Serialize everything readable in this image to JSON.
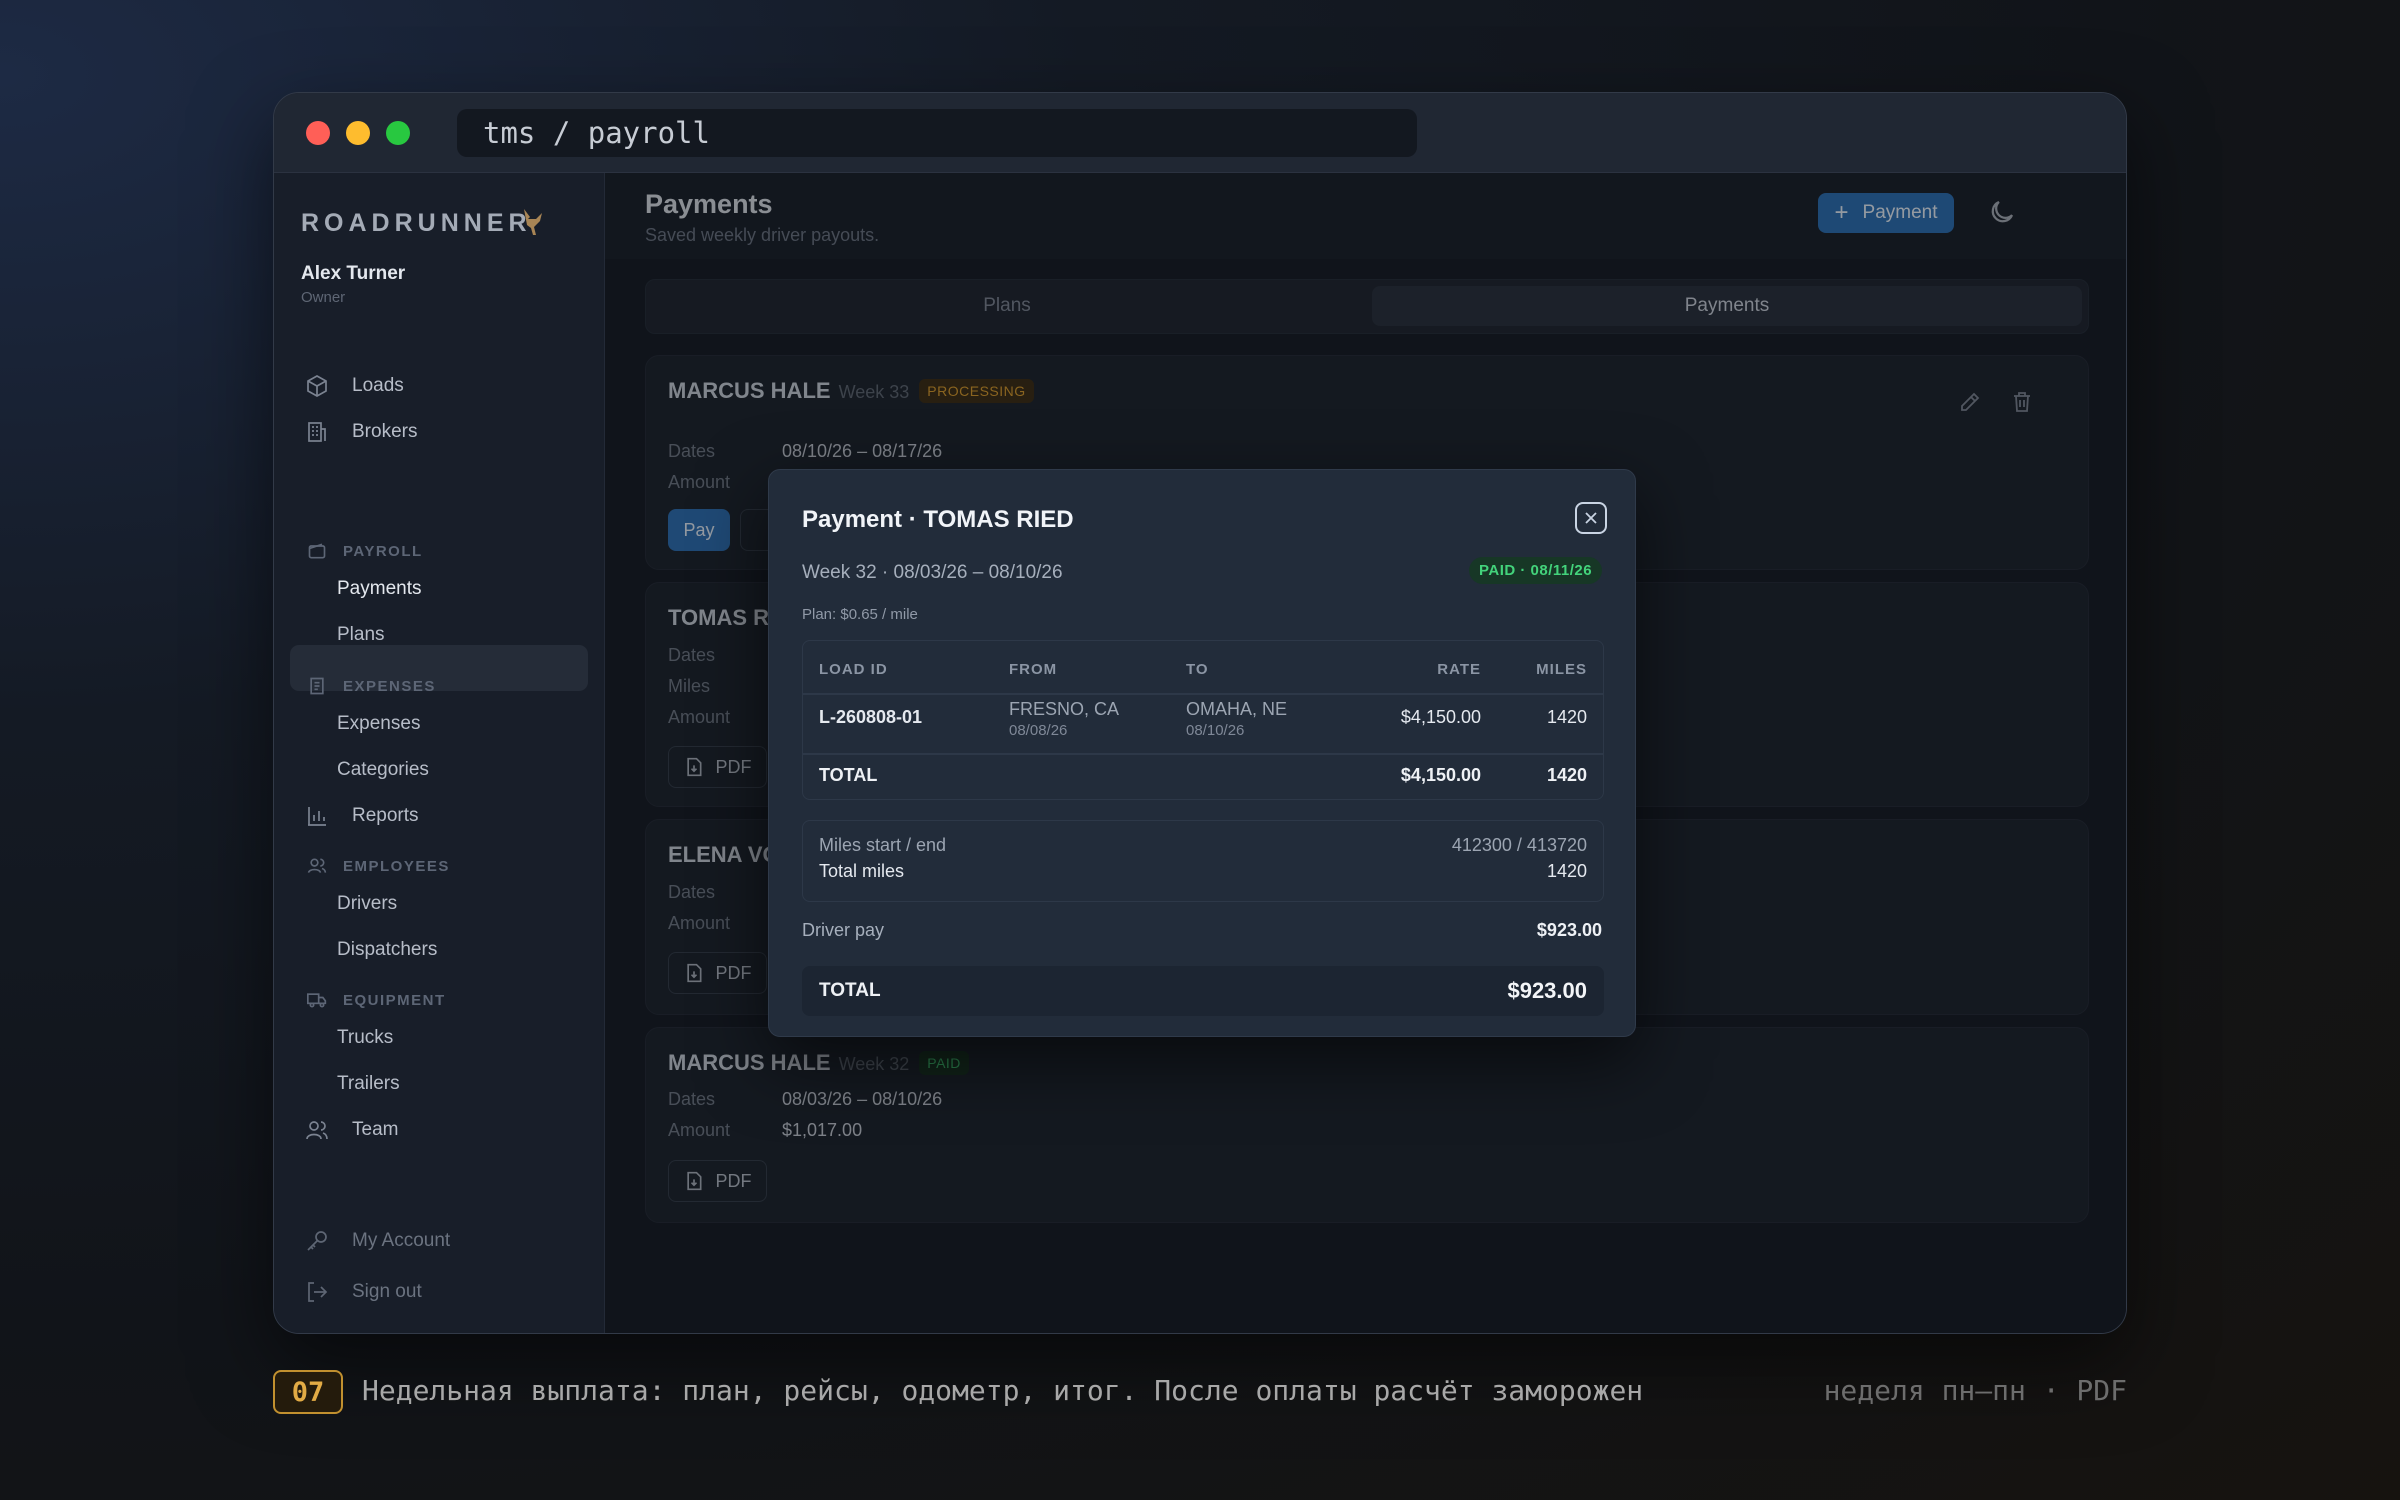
{
  "window": {
    "address": "tms / payroll"
  },
  "sidebar": {
    "brand": "ROADRUNNER",
    "user": {
      "name": "Alex Turner",
      "role": "Owner"
    },
    "items": {
      "loads": "Loads",
      "brokers": "Brokers",
      "payroll_section": "PAYROLL",
      "payments": "Payments",
      "plans": "Plans",
      "expenses_section": "EXPENSES",
      "expenses": "Expenses",
      "categories": "Categories",
      "reports": "Reports",
      "employees_section": "EMPLOYEES",
      "drivers": "Drivers",
      "dispatchers": "Dispatchers",
      "equipment_section": "EQUIPMENT",
      "trucks": "Trucks",
      "trailers": "Trailers",
      "team": "Team"
    },
    "footer": {
      "account": "My Account",
      "signout": "Sign out"
    }
  },
  "header": {
    "title": "Payments",
    "subtitle": "Saved weekly driver payouts.",
    "add_button": "Payment"
  },
  "tabs": {
    "plans": "Plans",
    "payments": "Payments"
  },
  "cards": [
    {
      "driver": "MARCUS HALE",
      "week": "Week 33",
      "status": "PROCESSING",
      "dates_label": "Dates",
      "dates": "08/10/26 – 08/17/26",
      "amount_label": "Amount",
      "pay_button": "Pay"
    },
    {
      "driver": "TOMAS RIED",
      "dates_label": "Dates",
      "miles_label": "Miles",
      "amount_label": "Amount",
      "pdf_button": "PDF"
    },
    {
      "driver": "ELENA VO",
      "dates_label": "Dates",
      "amount_label": "Amount",
      "pdf_button": "PDF"
    },
    {
      "driver": "MARCUS HALE",
      "week": "Week 32",
      "status": "PAID",
      "dates_label": "Dates",
      "dates": "08/03/26 – 08/10/26",
      "amount_label": "Amount",
      "amount": "$1,017.00",
      "pdf_button": "PDF"
    }
  ],
  "modal": {
    "title": "Payment · TOMAS RIED",
    "week": "Week 32 · 08/03/26 – 08/10/26",
    "status": "PAID · 08/11/26",
    "plan": "Plan: $0.65 / mile",
    "columns": {
      "load_id": "LOAD ID",
      "from": "FROM",
      "to": "TO",
      "rate": "RATE",
      "miles": "MILES"
    },
    "loads": [
      {
        "load_id": "L-260808-01",
        "from_city": "FRESNO, CA",
        "from_date": "08/08/26",
        "to_city": "OMAHA, NE",
        "to_date": "08/10/26",
        "rate": "$4,150.00",
        "miles": "1420"
      }
    ],
    "loads_total": {
      "label": "TOTAL",
      "rate": "$4,150.00",
      "miles": "1420"
    },
    "odometer": {
      "label": "Miles start / end",
      "value": "412300 / 413720",
      "total_label": "Total miles",
      "total_value": "1420"
    },
    "driver_pay": {
      "label": "Driver pay",
      "value": "$923.00"
    },
    "grand_total": {
      "label": "TOTAL",
      "value": "$923.00"
    }
  },
  "caption": {
    "number": "07",
    "text": "Недельная выплата: план, рейсы, одометр, итог. После оплаты расчёт заморожен",
    "right": "неделя пн–пн · PDF"
  },
  "colors": {
    "accent": "#2b6fb4",
    "paid": "#3ec26f",
    "processing": "#d99a2a",
    "caption_accent": "#e2ab45"
  }
}
